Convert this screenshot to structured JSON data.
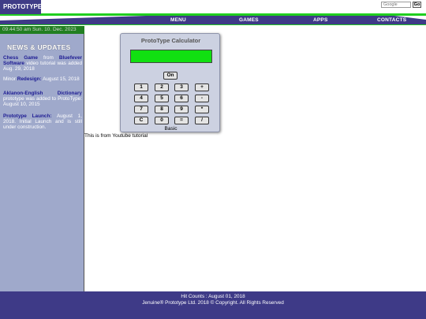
{
  "header": {
    "logo": "PROTOTYPE",
    "search_placeholder": "Google",
    "go_label": "Go"
  },
  "nav": {
    "items": [
      "MENU",
      "GAMES",
      "APPS",
      "CONTACTS"
    ]
  },
  "sidebar": {
    "datetime": "09:44:50 am Sun. 10. Dec. 2023",
    "news_title": "NEWS & UPDATES",
    "news": [
      {
        "title": "Chess Game",
        "mid": " from ",
        "title2": "Bluefever Software",
        "text": " video tutorial was added Aug. 29, 2018"
      },
      {
        "pre": "Minor ",
        "title": "Redesign:",
        "text": " August 15, 2018"
      },
      {
        "title": "Aklanon-English Dictionary",
        "text": " prototype was added to ProtoType: August 10, 2015"
      },
      {
        "title": "Prototype Launch:",
        "text": " August 1, 2018. Initial Launch and is still under construction."
      }
    ]
  },
  "calculator": {
    "title": "ProtoType Calculator",
    "display_value": "",
    "on_label": "On",
    "keys": [
      [
        "1",
        "2",
        "3",
        "+"
      ],
      [
        "4",
        "5",
        "6",
        "-"
      ],
      [
        "7",
        "8",
        "9",
        "*"
      ],
      [
        "C",
        "0",
        "=",
        "/"
      ]
    ],
    "mode_label": "Basic"
  },
  "caption": "This is from Youtube tutorial",
  "footer": {
    "hit_counts": "Hit Counts :   August 01, 2018",
    "copyright": "Jenuine® Prototype Ltd. 2018 © Copyright. All Rights Reserved"
  },
  "colors": {
    "brand": "#3e3a87",
    "accent_green": "#22cc22",
    "sidebar": "#9fa9cb",
    "display": "#11e011"
  }
}
